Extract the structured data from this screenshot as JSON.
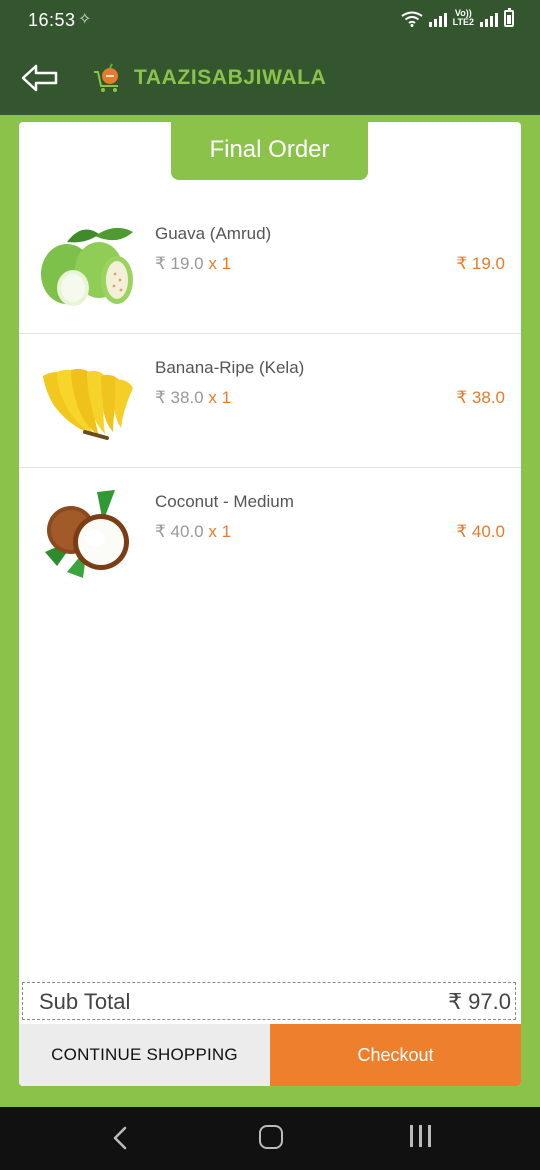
{
  "status": {
    "time": "16:53",
    "volte_top": "Vo))",
    "volte_bottom": "LTE2"
  },
  "app": {
    "title": "TAAZISABJIWALA"
  },
  "card": {
    "tab_title": "Final Order"
  },
  "items": [
    {
      "name": "Guava (Amrud)",
      "unit_price": "₹ 19.0",
      "qty": "x 1",
      "total": "₹ 19.0",
      "icon": "guava-image"
    },
    {
      "name": "Banana-Ripe (Kela)",
      "unit_price": "₹ 38.0",
      "qty": "x 1",
      "total": "₹ 38.0",
      "icon": "banana-image"
    },
    {
      "name": "Coconut - Medium",
      "unit_price": "₹ 40.0",
      "qty": "x 1",
      "total": "₹ 40.0",
      "icon": "coconut-image"
    }
  ],
  "summary": {
    "subtotal_label": "Sub Total",
    "subtotal_value": "₹ 97.0"
  },
  "actions": {
    "continue_label": "CONTINUE SHOPPING",
    "checkout_label": "Checkout"
  },
  "colors": {
    "header": "#33562E",
    "accent_green": "#8BC34A",
    "accent_orange": "#EE7F2D"
  }
}
